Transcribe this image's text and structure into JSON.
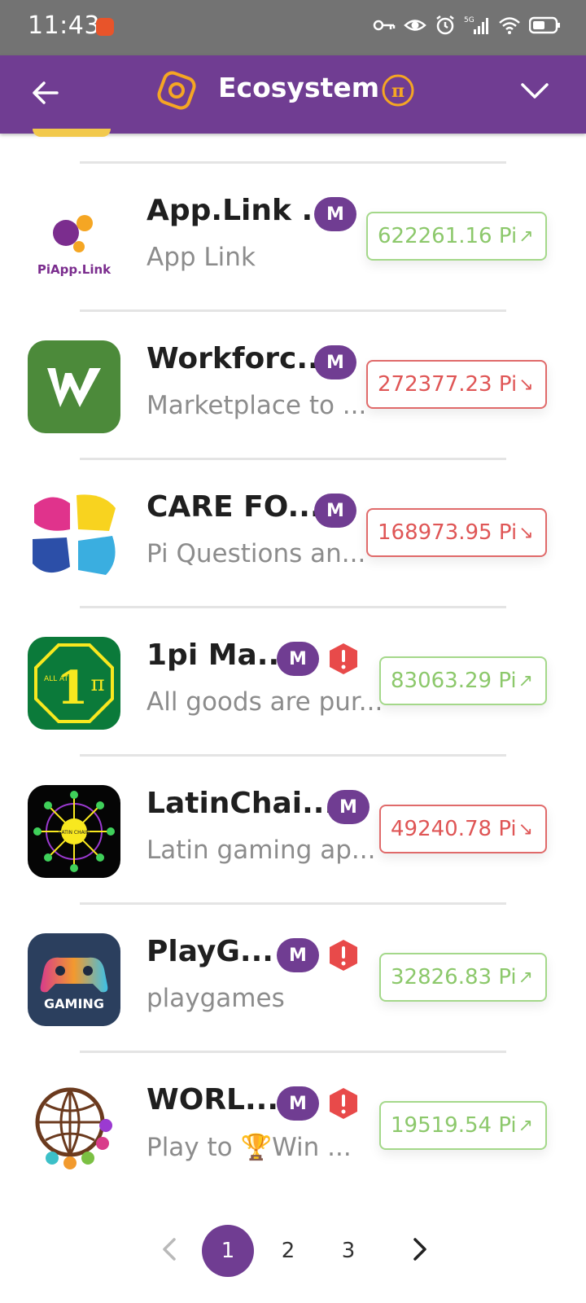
{
  "status_bar": {
    "time": "11:43"
  },
  "header": {
    "title": "Ecosystem"
  },
  "apps": [
    {
      "title": "App.Link ...",
      "subtitle": "App Link",
      "price": "622261.16 Pi",
      "trend": "up",
      "warning": false
    },
    {
      "title": "Workforc...",
      "subtitle": "Marketplace to ...",
      "price": "272377.23 Pi",
      "trend": "down",
      "warning": false
    },
    {
      "title": "CARE FO...",
      "subtitle": "Pi Questions an...",
      "price": "168973.95 Pi",
      "trend": "down",
      "warning": false
    },
    {
      "title": "1pi Ma...",
      "subtitle": "All goods are pur...",
      "price": "83063.29 Pi",
      "trend": "up",
      "warning": true
    },
    {
      "title": "LatinChai...",
      "subtitle": "Latin gaming ap...",
      "price": "49240.78 Pi",
      "trend": "down",
      "warning": false
    },
    {
      "title": "PlayG...",
      "subtitle": "playgames",
      "price": "32826.83 Pi",
      "trend": "up",
      "warning": true
    },
    {
      "title": "WORL...",
      "subtitle": "Play to 🏆Win ...",
      "price": "19519.54 Pi",
      "trend": "up",
      "warning": true
    }
  ],
  "badge_label": "M",
  "icon_texts": {
    "applink": "PiApp.Link",
    "allat": "ALL AT",
    "one": "1",
    "pi": "π",
    "latin": "LATIN CHAIN",
    "gaming": "GAMING"
  },
  "pagination": {
    "pages": [
      "1",
      "2",
      "3"
    ],
    "current": "1"
  },
  "colors": {
    "brand": "#703d92",
    "up": "#8cc86b",
    "down": "#df5656",
    "accent": "#f5a623"
  }
}
